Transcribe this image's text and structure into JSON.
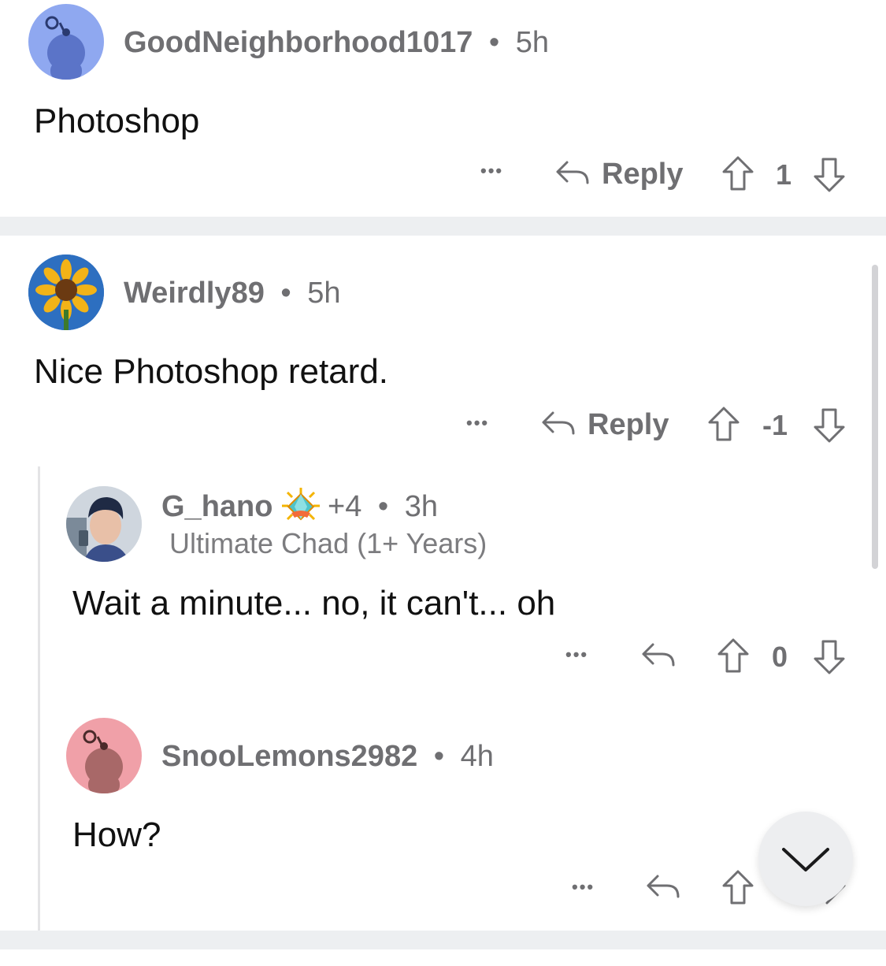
{
  "comments": [
    {
      "username": "GoodNeighborhood1017",
      "dot": "•",
      "time": "5h",
      "body": "Photoshop",
      "more_label": "•••",
      "reply_label": "Reply",
      "score": "1",
      "avatar_color": "#8fa8f0"
    },
    {
      "username": "Weirdly89",
      "dot": "•",
      "time": "5h",
      "body": "Nice Photoshop retard.",
      "more_label": "•••",
      "reply_label": "Reply",
      "score": "-1",
      "avatar_color": "#2d6fc0"
    },
    {
      "username": "G_hano",
      "award_count": "+4",
      "dot": "•",
      "time": "3h",
      "flair": "Ultimate Chad (1+ Years)",
      "body": "Wait a minute... no, it can't... oh",
      "more_label": "•••",
      "score": "0"
    },
    {
      "username": "SnooLemons2982",
      "dot": "•",
      "time": "4h",
      "body": "How?",
      "more_label": "•••",
      "avatar_color": "#f0a0a8"
    }
  ],
  "colors": {
    "separator": "#edeff1",
    "muted_text": "#6f6f72",
    "thread_line": "#e4e4e6",
    "fab_background": "#edeef0"
  },
  "icons": [
    "snoo-avatar-icon",
    "sunflower-avatar-icon",
    "reply-arrow-icon",
    "upvote-arrow-icon",
    "downvote-arrow-icon",
    "more-dots-icon",
    "chevron-down-icon",
    "award-icon"
  ]
}
